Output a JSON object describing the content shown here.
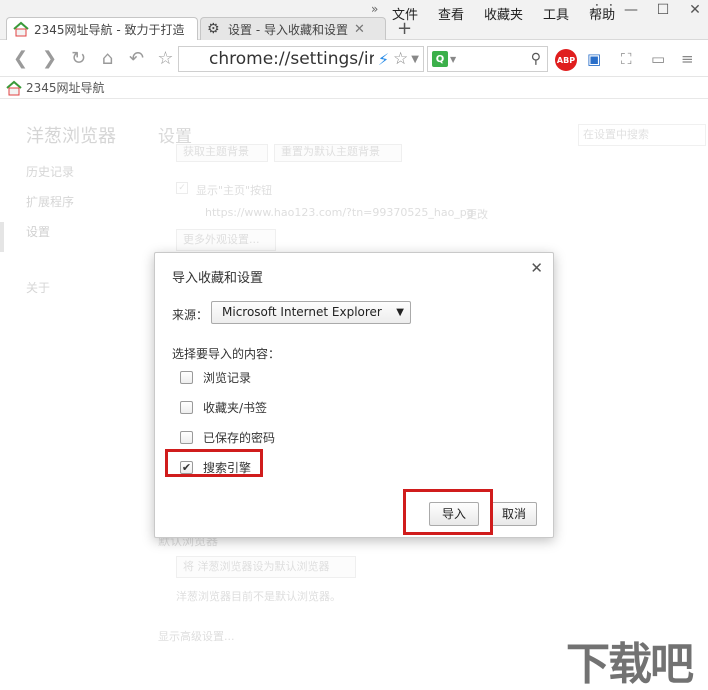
{
  "tabs": [
    {
      "title": "2345网址导航 - 致力于打造",
      "active": true
    },
    {
      "title": "设置 - 导入收藏和设置",
      "active": false
    }
  ],
  "menubar": [
    "文件",
    "查看",
    "收藏夹",
    "工具",
    "帮助"
  ],
  "omnibox": {
    "url": "chrome://settings/ir"
  },
  "extensions": {
    "abp_label": "ABP"
  },
  "bookmarks_bar": {
    "item": "2345网址导航"
  },
  "settings": {
    "brand": "洋葱浏览器",
    "title": "设置",
    "search_placeholder": "在设置中搜索",
    "nav": [
      "历史记录",
      "扩展程序",
      "设置",
      "关于"
    ],
    "appearance": {
      "btn_theme": "获取主题背景",
      "btn_reset_theme": "重置为默认主题背景",
      "show_home": "显示\"主页\"按钮",
      "home_url": "https://www.hao123.com/?tn=99370525_hao_pg",
      "change_link": "更改",
      "more_appearance": "更多外观设置..."
    },
    "default_browser": {
      "heading": "默认浏览器",
      "btn": "将 洋葱浏览器设为默认浏览器",
      "status": "洋葱浏览器目前不是默认浏览器。"
    },
    "advanced_link": "显示高级设置..."
  },
  "dialog": {
    "title": "导入收藏和设置",
    "source_label": "来源：",
    "source_value": "Microsoft Internet Explorer",
    "items_label": "选择要导入的内容：",
    "options": [
      {
        "label": "浏览记录",
        "checked": false
      },
      {
        "label": "收藏夹/书签",
        "checked": false
      },
      {
        "label": "已保存的密码",
        "checked": false
      },
      {
        "label": "搜索引擎",
        "checked": true
      }
    ],
    "import_label": "导入",
    "cancel_label": "取消"
  }
}
